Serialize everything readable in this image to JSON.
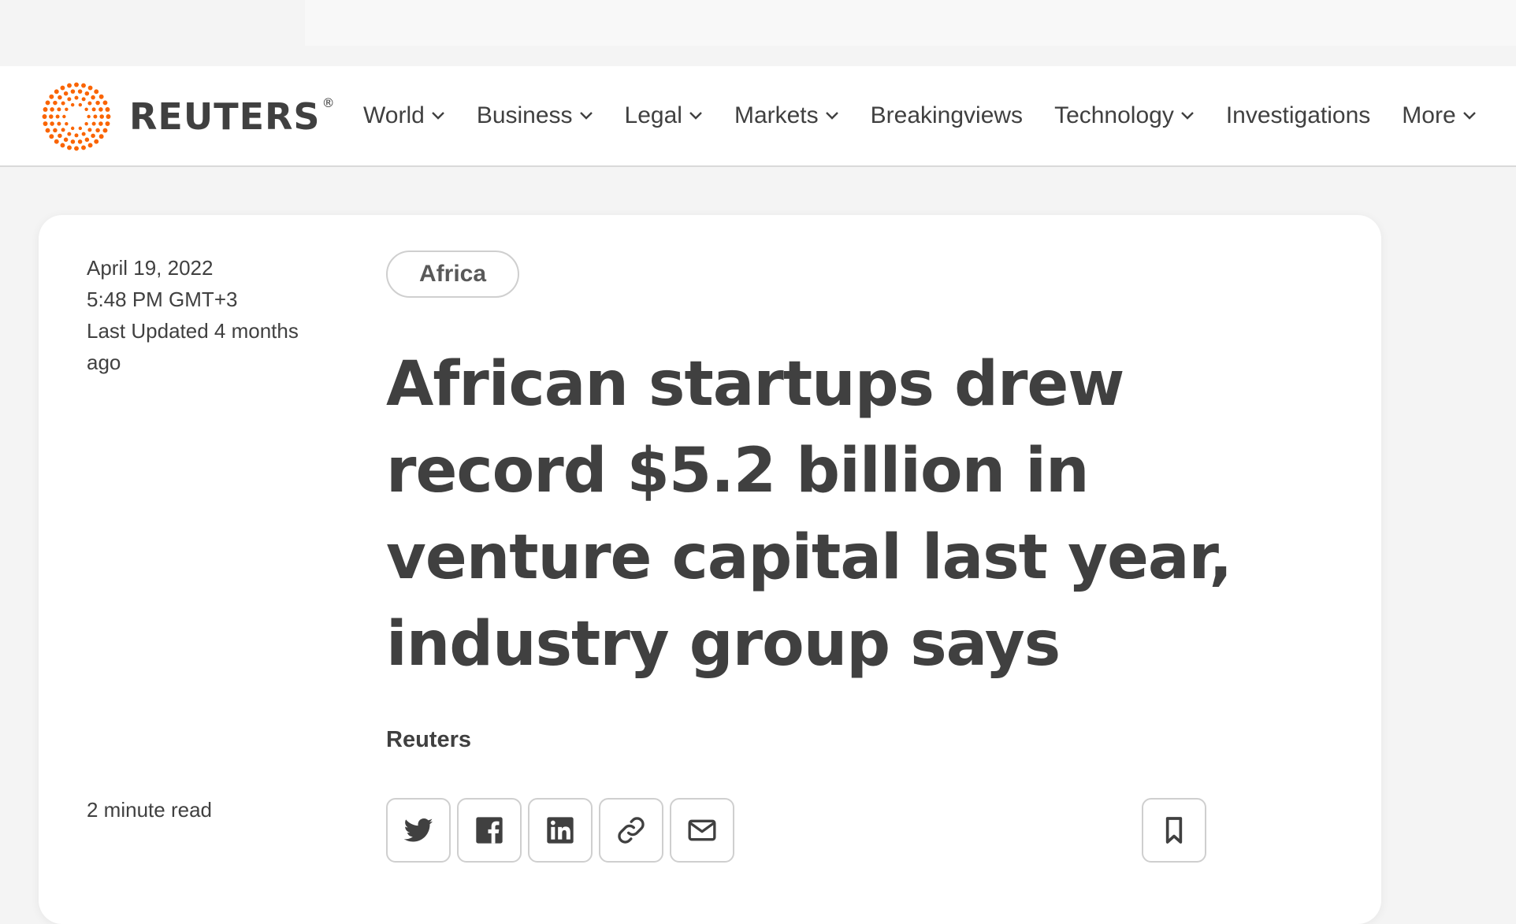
{
  "brand": {
    "name": "REUTERS",
    "registered": "®",
    "accent": "#fa6400"
  },
  "nav": {
    "items": [
      {
        "label": "World",
        "dropdown": true
      },
      {
        "label": "Business",
        "dropdown": true
      },
      {
        "label": "Legal",
        "dropdown": true
      },
      {
        "label": "Markets",
        "dropdown": true
      },
      {
        "label": "Breakingviews",
        "dropdown": false
      },
      {
        "label": "Technology",
        "dropdown": true
      },
      {
        "label": "Investigations",
        "dropdown": false
      },
      {
        "label": "More",
        "dropdown": true
      }
    ]
  },
  "article": {
    "date": "April 19, 2022",
    "time": "5:48 PM GMT+3",
    "updated": "Last Updated 4 months ago",
    "read_time": "2 minute read",
    "tag": "Africa",
    "headline": "African startups drew record $5.2 billion in venture capital last year, industry group says",
    "byline": "Reuters"
  },
  "share": {
    "buttons": [
      {
        "icon": "twitter-icon"
      },
      {
        "icon": "facebook-icon"
      },
      {
        "icon": "linkedin-icon"
      },
      {
        "icon": "link-icon"
      },
      {
        "icon": "email-icon"
      }
    ],
    "bookmark_icon": "bookmark-icon"
  },
  "colors": {
    "text": "#404040",
    "border": "#cfcfcf",
    "background": "#f4f4f4",
    "card": "#ffffff"
  }
}
